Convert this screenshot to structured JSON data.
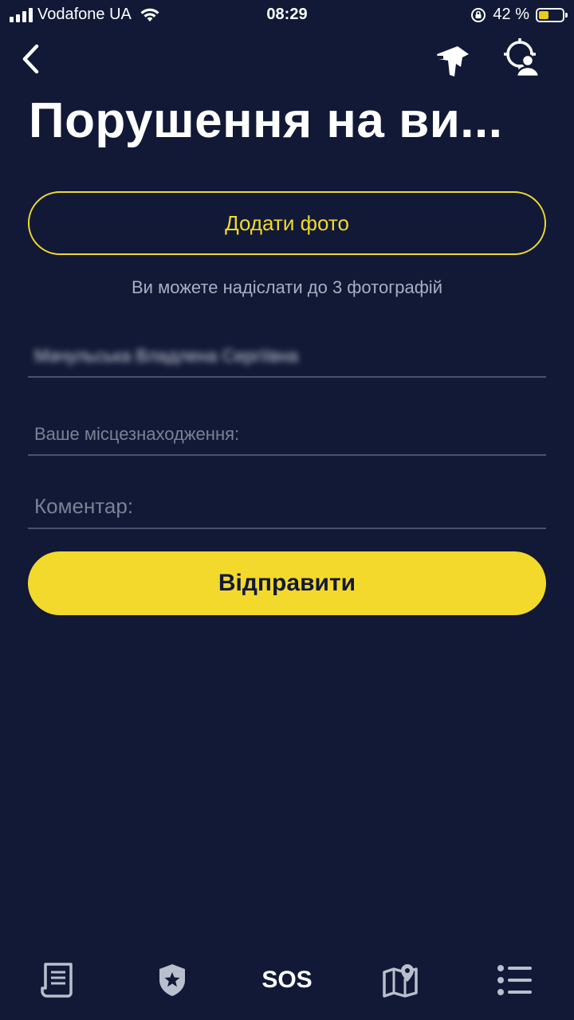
{
  "status_bar": {
    "carrier": "Vodafone UA",
    "time": "08:29",
    "battery_percent": "42 %",
    "battery_level": 0.42,
    "battery_color": "#f4d51c"
  },
  "header": {
    "back_icon": "chevron-left-icon",
    "action_icons": [
      "megaphone-icon",
      "target-person-icon"
    ],
    "title": "Порушення на ви..."
  },
  "form": {
    "add_photo_label": "Додати фото",
    "photo_hint": "Ви можете надіслати до 3 фотографій",
    "name_value": "Мачульська Владлена Сергіївна",
    "location_placeholder": "Ваше місцезнаходження:",
    "comment_placeholder": "Коментар:",
    "submit_label": "Відправити"
  },
  "tab_bar": {
    "items": [
      {
        "icon": "document-list-icon"
      },
      {
        "icon": "shield-star-icon"
      },
      {
        "label": "SOS"
      },
      {
        "icon": "map-pin-icon"
      },
      {
        "icon": "menu-list-icon"
      }
    ]
  },
  "colors": {
    "background": "#111936",
    "accent": "#f3d92c",
    "muted_text": "#a9afc2",
    "divider": "#4b526b"
  }
}
